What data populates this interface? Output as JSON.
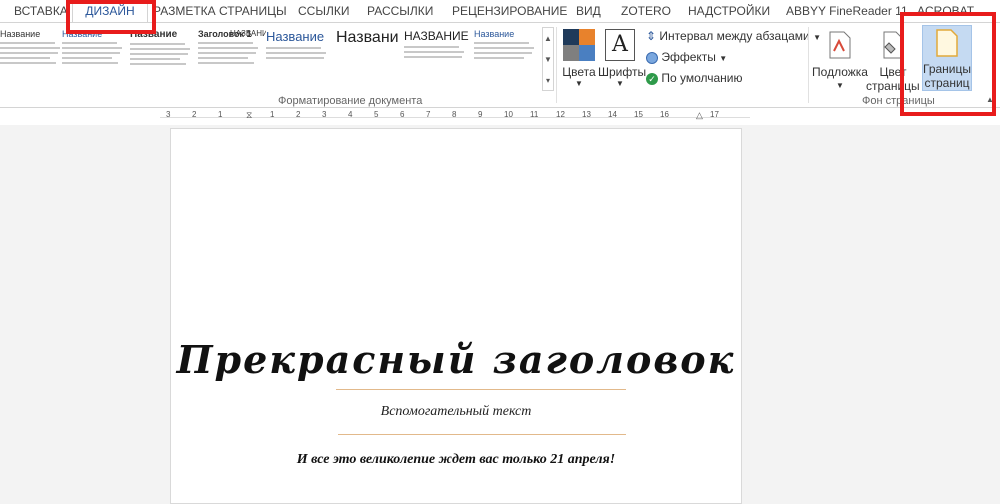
{
  "tabs": [
    "ВСТАВКА",
    "ДИЗАЙН",
    "РАЗМЕТКА СТРАНИЦЫ",
    "ССЫЛКИ",
    "РАССЫЛКИ",
    "РЕЦЕНЗИРОВАНИЕ",
    "ВИД",
    "ZOTERO",
    "НАДСТРОЙКИ",
    "ABBYY FineReader 11",
    "ACROBAT"
  ],
  "ribbon": {
    "styles": [
      {
        "title": "Название"
      },
      {
        "title": "Название"
      },
      {
        "title": "Название"
      },
      {
        "title": "Заголовок 1"
      },
      {
        "title": "НАЗВАНИЕ"
      },
      {
        "title": "Название"
      },
      {
        "title": "Названи"
      },
      {
        "title": "НАЗВАНИЕ"
      },
      {
        "title": "Название"
      }
    ],
    "doc_format_label": "Форматирование документа",
    "colors_label": "Цвета",
    "fonts_label": "Шрифты",
    "fonts_letter": "A",
    "paragraph_spacing": "Интервал между абзацами",
    "effects": "Эффекты",
    "default": "По умолчанию",
    "watermark": "Подложка",
    "page_color_1": "Цвет",
    "page_color_2": "страницы",
    "page_borders_1": "Границы",
    "page_borders_2": "страниц",
    "page_bg_label": "Фон страницы"
  },
  "ruler": [
    "3",
    "2",
    "1",
    "1",
    "2",
    "3",
    "4",
    "5",
    "6",
    "7",
    "8",
    "9",
    "10",
    "11",
    "12",
    "13",
    "14",
    "15",
    "16",
    "17"
  ],
  "document": {
    "title": "Прекрасный  заголовок",
    "subtitle": "Вспомогательный текст",
    "footer": "И все это великолепие ждет вас только 21 апреля!"
  },
  "colors": {
    "accent": "#2b579a",
    "highlight": "#e81c1c",
    "gold": "#e2b98b"
  }
}
